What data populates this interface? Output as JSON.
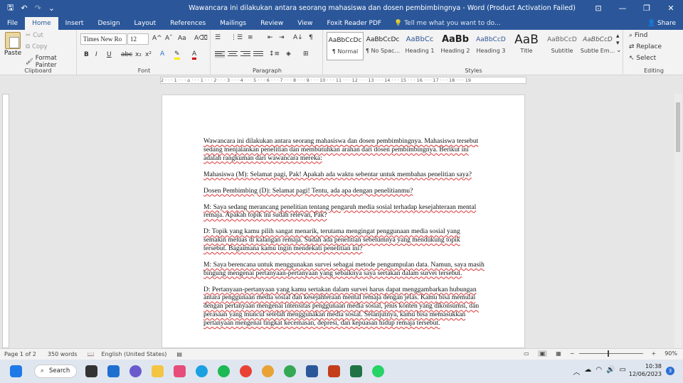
{
  "titlebar": {
    "title": "Wawancara ini dilakukan antara seorang mahasiswa dan dosen pembimbingnya - Word (Product Activation Failed)",
    "save_icon": "save-icon",
    "undo_icon": "undo-icon",
    "redo_icon": "redo-icon",
    "minimize": "—",
    "restore": "❐",
    "close": "✕"
  },
  "tabs": [
    "File",
    "Home",
    "Insert",
    "Design",
    "Layout",
    "References",
    "Mailings",
    "Review",
    "View",
    "Foxit Reader PDF"
  ],
  "active_tab": "Home",
  "tell_me": "Tell me what you want to do...",
  "share": "Share",
  "clipboard": {
    "paste": "Paste",
    "cut": "Cut",
    "copy": "Copy",
    "format_painter": "Format Painter",
    "label": "Clipboard"
  },
  "font": {
    "name": "Times New Ro",
    "size": "12",
    "label": "Font",
    "bold": "B",
    "italic": "I",
    "underline": "U",
    "strike": "abc",
    "sub": "x₂",
    "sup": "x²",
    "grow": "A^",
    "shrink": "Aˇ",
    "case": "Aa",
    "clear": "A⌫"
  },
  "paragraph": {
    "label": "Paragraph"
  },
  "styles": {
    "label": "Styles",
    "items": [
      {
        "sample": "AaBbCcDc",
        "name": "¶ Normal"
      },
      {
        "sample": "AaBbCcDc",
        "name": "¶ No Spac..."
      },
      {
        "sample": "AaBbCc",
        "name": "Heading 1"
      },
      {
        "sample": "AaBb",
        "name": "Heading 2"
      },
      {
        "sample": "AaBbCcD",
        "name": "Heading 3"
      },
      {
        "sample": "AaB",
        "name": "Title"
      },
      {
        "sample": "AaBbCcD",
        "name": "Subtitle"
      },
      {
        "sample": "AaBbCcD",
        "name": "Subtle Em..."
      }
    ]
  },
  "editing": {
    "find": "Find",
    "replace": "Replace",
    "select": "Select",
    "label": "Editing"
  },
  "ruler_text": "2 · · · 1 · · · ⌂ · · · 1 · · · 2 · · · 3 · · · 4 · · · 5 · · · 6 · · · 7 · · · 8 · · · 9 · · · 10 · · · 11 · · · 12 · · · 13 · · · 14 · · · 15 · · · 16 · · · 17 · · · 18 · · · 19",
  "document": {
    "paragraphs": [
      "Wawancara ini dilakukan antara seorang mahasiswa dan dosen pembimbingnya. Mahasiswa tersebut sedang menjalankan penelitian dan membutuhkan arahan dari dosen pembimbingnya. Berikut ini adalah rangkuman dari wawancara mereka:",
      "Mahasiswa (M): Selamat pagi, Pak! Apakah ada waktu sebentar untuk membahas penelitian saya?",
      "Dosen Pembimbing (D): Selamat pagi! Tentu, ada apa dengan penelitianmu?",
      "M: Saya sedang merancang penelitian tentang pengaruh media sosial terhadap kesejahteraan mental remaja. Apakah topik ini sudah relevan, Pak?",
      "D: Topik yang kamu pilih sangat menarik, terutama mengingat penggunaan media sosial yang semakin meluas di kalangan remaja. Sudah ada penelitian sebelumnya yang mendukung topik tersebut. Bagaimana kamu ingin mendekati penelitian ini?",
      "M: Saya berencana untuk menggunakan survei sebagai metode pengumpulan data. Namun, saya masih bingung mengenai pertanyaan-pertanyaan yang sebaiknya saya sertakan dalam survei tersebut.",
      "D: Pertanyaan-pertanyaan yang kamu sertakan dalam survei harus dapat menggambarkan hubungan antara penggunaan media sosial dan kesejahteraan mental remaja dengan jelas. Kamu bisa memulai dengan pertanyaan mengenai intensitas penggunaan media sosial, jenis konten yang dikonsumsi, dan perasaan yang muncul setelah menggunakan media sosial. Selanjutnya, kamu bisa memasukkan pertanyaan mengenai tingkat kecemasan, depresi, dan kepuasan hidup remaja tersebut."
    ]
  },
  "status": {
    "page": "Page 1 of 2",
    "words": "350 words",
    "language": "English (United States)",
    "zoom": "90%"
  },
  "taskbar": {
    "search": "Search",
    "time": "10:38",
    "date": "12/06/2023",
    "badge": "3"
  }
}
